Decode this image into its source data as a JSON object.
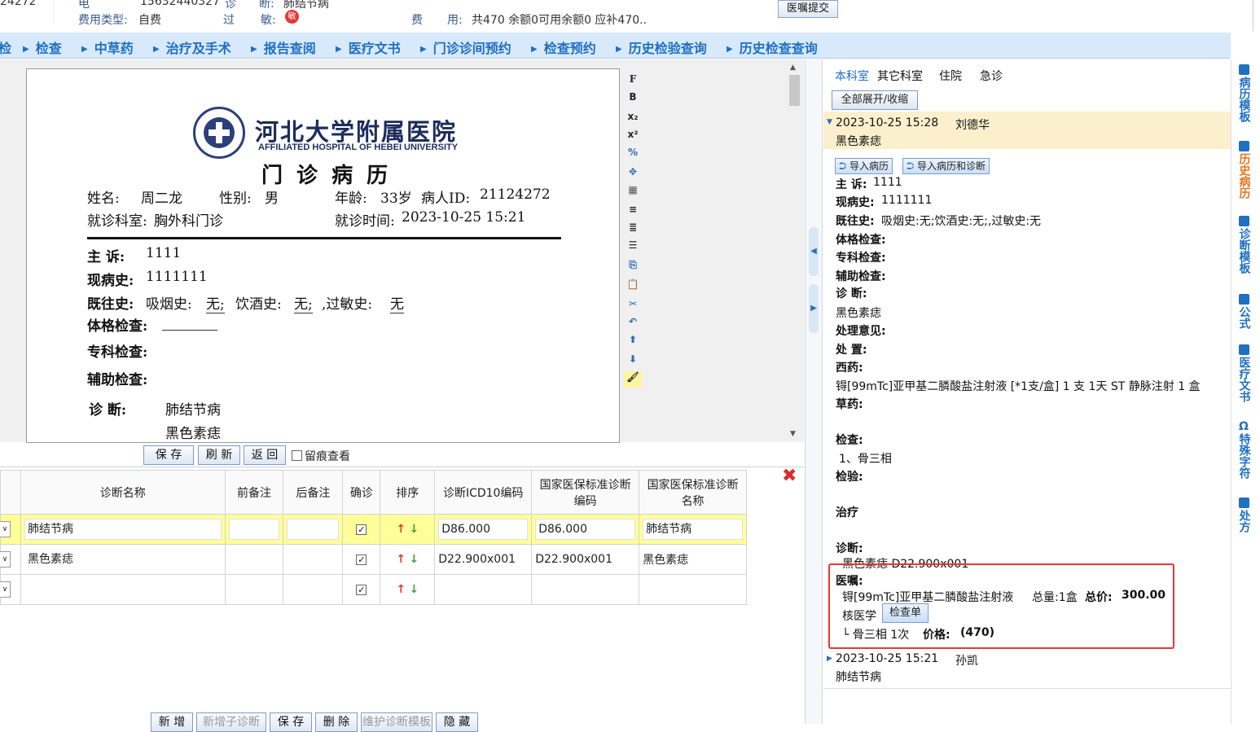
{
  "header": {
    "patient_id_partial": "24272",
    "phone_label": "电",
    "phone_value": "15632440327",
    "diag_label": "诊",
    "diag_prefix": "断:",
    "diag_value": "肺结节病",
    "fee_type_label": "费用类型:",
    "fee_type_value": "自费",
    "allergy_label_1": "过",
    "allergy_label_2": "敏:",
    "allergy_badge": "敏",
    "fee_label_1": "费",
    "fee_label_2": "用:",
    "fee_value": "共470 余额0可用余额0 应补470..",
    "submit_button": "医嘱提交"
  },
  "nav": [
    "检",
    "检查",
    "中草药",
    "治疗及手术",
    "报告查阅",
    "医疗文书",
    "门诊诊间预约",
    "检查预约",
    "历史检验查询",
    "历史检查查询"
  ],
  "doc": {
    "hospital_cn": "河北大学附属医院",
    "hospital_en": "AFFILIATED HOSPITAL OF HEBEI UNIVERSITY",
    "title": "门 诊 病 历",
    "name_label": "姓名:",
    "name_value": "周二龙",
    "sex_label": "性别:",
    "sex_value": "男",
    "age_label": "年龄:",
    "age_value": "33岁",
    "pid_label": "病人ID:",
    "pid_value": "21124272",
    "dept_label": "就诊科室:",
    "dept_value": "胸外科门诊",
    "time_label": "就诊时间:",
    "time_value": "2023-10-25 15:21",
    "complaint_label": "主  诉:",
    "complaint_value": "1111",
    "present_label": "现病史:",
    "present_value": "1111111",
    "past_label": "既往史:",
    "smoke_label": "吸烟史:",
    "smoke_value": "无;",
    "drink_label": "饮酒史:",
    "drink_value": "无;",
    "allergy_label": ",过敏史:",
    "allergy_value": "无",
    "exam_label": "体格检查:",
    "special_label": "专科检查:",
    "aux_label": "辅助检查:",
    "diag_label": "诊    断:",
    "diag_1": "肺结节病",
    "diag_2": "黑色素痣"
  },
  "toolbar": [
    "F",
    "B",
    "x₂",
    "x²",
    "%",
    "✥",
    "▦",
    "≡",
    "≣",
    "☰",
    "⎘",
    "📋",
    "✂",
    "↶",
    "⬆",
    "⬇",
    "🖌"
  ],
  "editor_buttons": {
    "save": "保 存",
    "refresh": "刷 新",
    "back": "返 回",
    "trace": "留痕查看"
  },
  "grid": {
    "headers": [
      "诊断名称",
      "前备注",
      "后备注",
      "确诊",
      "排序",
      "诊断ICD10编码",
      "国家医保标准诊断编码",
      "国家医保标准诊断名称"
    ],
    "rows": [
      {
        "name": "肺结节病",
        "pre": "",
        "post": "",
        "confirm": "✓",
        "icd": "D86.000",
        "nat_code": "D86.000",
        "nat_name": "肺结节病"
      },
      {
        "name": "黑色素痣",
        "pre": "",
        "post": "",
        "confirm": "✓",
        "icd": "D22.900x001",
        "nat_code": "D22.900x001",
        "nat_name": "黑色素痣"
      },
      {
        "name": "",
        "pre": "",
        "post": "",
        "confirm": "✓",
        "icd": "",
        "nat_code": "",
        "nat_name": ""
      }
    ]
  },
  "bottom_buttons": [
    "新 增",
    "新增子诊断",
    "保 存",
    "删 除",
    "维护诊断模板",
    "隐 藏"
  ],
  "right": {
    "tabs": [
      "本科室",
      "其它科室",
      "住院",
      "急诊"
    ],
    "expand_button": "全部展开/收缩",
    "rec1_time": "2023-10-25 15:28",
    "rec1_doctor": "刘德华",
    "rec1_diag": "黑色素痣",
    "import_record": "导入病历",
    "import_record_diag": "导入病历和诊断",
    "complaint_label": "主 诉:",
    "complaint_value": "1111",
    "present_label": "现病史:",
    "present_value": "1111111",
    "past_label": "既往史:",
    "past_value": "吸烟史:无;饮酒史:无;,过敏史:无",
    "exam_label": "体格检查:",
    "special_label": "专科检查:",
    "aux_label": "辅助检查:",
    "diag_label": "诊 断:",
    "diag_value": "黑色素痣",
    "handling_label": "处理意见:",
    "disposal_label": "处 置:",
    "western_label": "西药:",
    "western_value": "锝[99mTc]亚甲基二膦酸盐注射液 [*1支/盒] 1 支 1天 ST 静脉注射 1 盒",
    "herbal_label": "草药:",
    "check_label": "检查:",
    "check_value": "1、骨三相",
    "lab_label": "检验:",
    "treat_label": "治疗",
    "diag2_label": "诊断:",
    "diag2_value": "黑色素痣    D22.900x001",
    "order_label": "医嘱:",
    "order_drug": "锝[99mTc]亚甲基二膦酸盐注射液",
    "order_total_label": "总量:1盒",
    "order_price_label": "总价:",
    "order_price": "300.00",
    "order_dept": "核医学",
    "order_sheet_btn": "检查单",
    "order_item": "└  骨三相  1次",
    "order_item_price_label": "价格:",
    "order_item_price": "(470)",
    "rec2_time": "2023-10-25 15:21",
    "rec2_doctor": "孙凯",
    "rec2_diag": "肺结节病"
  },
  "sidebar": [
    "病历模板",
    "历史病历",
    "诊断模板",
    "公式",
    "医疗文书",
    "特殊字符",
    "处方"
  ]
}
